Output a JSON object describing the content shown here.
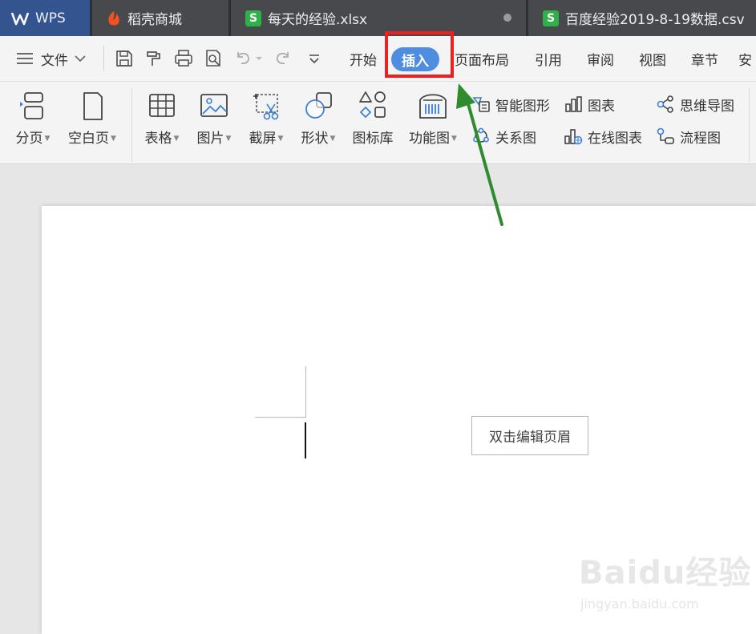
{
  "tabs": {
    "wps": "WPS",
    "daoke": "稻壳商城",
    "file1": "每天的经验.xlsx",
    "file2": "百度经验2019-8-19数据.csv"
  },
  "menu": {
    "file": "文件",
    "start": "开始",
    "insert": "插入",
    "page_layout": "页面布局",
    "reference": "引用",
    "review": "审阅",
    "view": "视图",
    "chapter": "章节",
    "security": "安"
  },
  "ribbon": {
    "page_break": "分页",
    "blank_page": "空白页",
    "table": "表格",
    "picture": "图片",
    "screenshot": "截屏",
    "shape": "形状",
    "icon_lib": "图标库",
    "func_chart": "功能图",
    "smart_graphic": "智能图形",
    "relation": "关系图",
    "chart": "图表",
    "online_chart": "在线图表",
    "mind_map": "思维导图",
    "flowchart": "流程图"
  },
  "document": {
    "header_tip": "双击编辑页眉"
  },
  "watermark": {
    "brand": "Baidu经验",
    "url": "jingyan.baidu.com"
  },
  "colors": {
    "accent": "#4e8de0",
    "highlight": "#ee1f1f",
    "arrow": "#2e8b2e",
    "sheet_icon": "#2fb14a"
  }
}
